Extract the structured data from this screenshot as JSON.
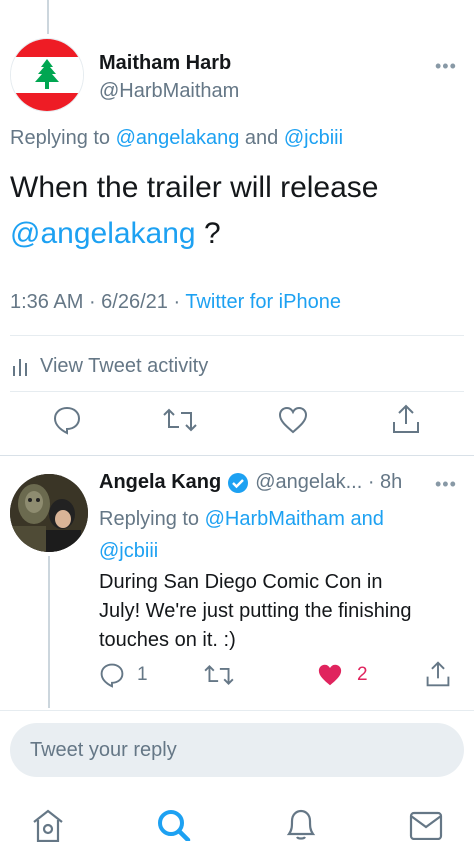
{
  "tweet": {
    "author_name": "Maitham Harb",
    "author_handle": "@HarbMaitham",
    "replying_prefix": "Replying to ",
    "replying_user1": "@angelakang",
    "replying_and": " and ",
    "replying_user2": "@jcbiii",
    "text_line1": "When the trailer will release",
    "text_mention": "@angelakang",
    "text_end": " ?",
    "time": "1:36 AM",
    "sep1": " · ",
    "date": "6/26/21",
    "sep2": " · ",
    "source": "Twitter for iPhone",
    "activity_label": "View Tweet activity",
    "more": "•••"
  },
  "reply": {
    "author_name": "Angela Kang",
    "handle_time": "@angelak... · 8h",
    "replying_prefix": "Replying to ",
    "replying_user1": "@HarbMaitham",
    "replying_and": " and",
    "replying_user2": "@jcbiii",
    "text_line1": "During San Diego Comic Con in",
    "text_line2": "July! We're just putting the finishing",
    "text_line3": "touches on it. :)",
    "reply_count": "1",
    "like_count": "2",
    "more": "•••"
  },
  "compose": {
    "placeholder": "Tweet your reply"
  },
  "colors": {
    "accent": "#1da1f2",
    "like": "#e0245e",
    "secondary_text": "#657786"
  },
  "bottom_nav": [
    "home-icon",
    "search-icon",
    "notifications-icon",
    "messages-icon"
  ]
}
